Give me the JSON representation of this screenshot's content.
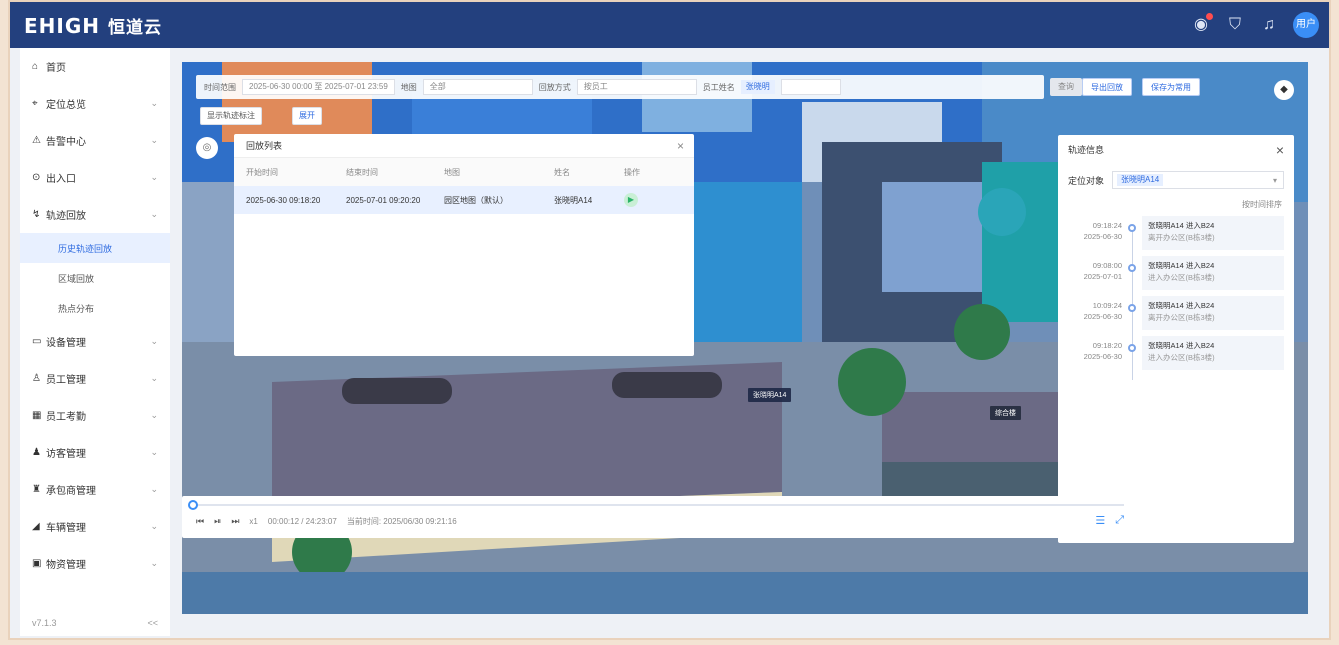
{
  "app": {
    "logo_en": "EHIGH",
    "logo_cn": "恒道云",
    "avatar_text": "用户"
  },
  "sidebar": {
    "items": [
      {
        "label": "首页",
        "icon": "home-icon"
      },
      {
        "label": "定位总览",
        "icon": "location-icon"
      },
      {
        "label": "告警中心",
        "icon": "alarm-icon"
      },
      {
        "label": "出入口",
        "icon": "gate-icon"
      },
      {
        "label": "轨迹回放",
        "icon": "track-icon"
      },
      {
        "label": "设备管理",
        "icon": "device-icon"
      },
      {
        "label": "员工管理",
        "icon": "user-icon"
      },
      {
        "label": "员工考勤",
        "icon": "calendar-icon"
      },
      {
        "label": "访客管理",
        "icon": "visitor-icon"
      },
      {
        "label": "承包商管理",
        "icon": "contractor-icon"
      },
      {
        "label": "车辆管理",
        "icon": "car-icon"
      },
      {
        "label": "物资管理",
        "icon": "box-icon"
      }
    ],
    "subitems": [
      {
        "label": "历史轨迹回放",
        "active": true
      },
      {
        "label": "区域回放",
        "active": false
      },
      {
        "label": "热点分布",
        "active": false
      }
    ],
    "version": "v7.1.3",
    "collapse": "<<"
  },
  "filter": {
    "time_label": "时间范围",
    "time_value": "2025-06-30 00:00 至 2025-07-01 23:59",
    "map_label": "地图",
    "map_value": "全部",
    "mode_label": "回放方式",
    "mode_value": "按员工",
    "person_label": "员工姓名",
    "person_tag": "张晓明",
    "search_btn": "查询",
    "reset_btn": "重置",
    "export_btn": "导出回放",
    "save_btn": "保存为常用",
    "row2_a": "显示轨迹标注",
    "row2_b": "展开"
  },
  "left_panel": {
    "title": "回放列表",
    "columns": [
      "开始时间",
      "结束时间",
      "地图",
      "姓名",
      "操作"
    ],
    "rows": [
      {
        "start": "2025-06-30 09:18:20",
        "end": "2025-07-01 09:20:20",
        "map": "园区地图（默认）",
        "name": "张晓明A14",
        "op": "▶"
      }
    ]
  },
  "right_panel": {
    "title": "轨迹信息",
    "person_label": "定位对象",
    "person_tag": "张晓明A14",
    "sort_text": "按时间排序",
    "timeline": [
      {
        "time": "09:18:24",
        "date": "2025-06-30",
        "title": "张晓明A14 进入B24",
        "sub": "离开办公区(B栋3楼)"
      },
      {
        "time": "09:08:00",
        "date": "2025-07-01",
        "title": "张晓明A14 进入B24",
        "sub": "进入办公区(B栋3楼)"
      },
      {
        "time": "10:09:24",
        "date": "2025-06-30",
        "title": "张晓明A14 进入B24",
        "sub": "离开办公区(B栋3楼)"
      },
      {
        "time": "09:18:20",
        "date": "2025-06-30",
        "title": "张晓明A14 进入B24",
        "sub": "进入办公区(B栋3楼)"
      }
    ]
  },
  "playbar": {
    "progress": 0.0,
    "speed": "x1",
    "time_range": "00:00:12 / 24:23:07",
    "current": "当前时间: 2025/06/30 09:21:16"
  },
  "map_labels": {
    "tag1": "张晓明A14",
    "tag2": "综合楼",
    "tag3": "张晓明A14"
  }
}
